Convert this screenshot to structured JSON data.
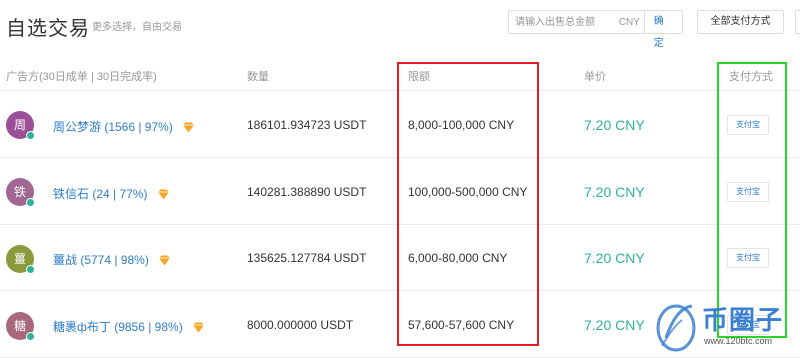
{
  "header": {
    "title": "自选交易",
    "subtitle": "更多选择，自由交易",
    "amount_placeholder": "请输入出售总金额",
    "currency": "CNY",
    "confirm_label": "确定",
    "payment_filter_label": "全部支付方式"
  },
  "columns": {
    "advertiser": "广告方(30日成单 | 30日完成率)",
    "quantity": "数量",
    "limit": "限额",
    "price": "单价",
    "payment": "支付方式"
  },
  "rows": [
    {
      "avatar": "周",
      "avatar_color": "#9b4f96",
      "merchant": "周公梦游 (1566 | 97%)",
      "quantity": "186101.934723 USDT",
      "limit": "8,000-100,000 CNY",
      "price": "7.20 CNY",
      "payment": "支付宝"
    },
    {
      "avatar": "铁",
      "avatar_color": "#a06792",
      "merchant": "铁信石 (24 | 77%)",
      "quantity": "140281.388890 USDT",
      "limit": "100,000-500,000 CNY",
      "price": "7.20 CNY",
      "payment": "支付宝"
    },
    {
      "avatar": "薑",
      "avatar_color": "#8a9a3c",
      "merchant": "薑战 (5774 | 98%)",
      "quantity": "135625.127784 USDT",
      "limit": "6,000-80,000 CNY",
      "price": "7.20 CNY",
      "payment": "支付宝"
    },
    {
      "avatar": "糖",
      "avatar_color": "#a9697c",
      "merchant": "糖裹ф布丁 (9856 | 98%)",
      "quantity": "8000.000000 USDT",
      "limit": "57,600-57,600 CNY",
      "price": "7.20 CNY",
      "payment": "支付宝"
    }
  ],
  "watermark": {
    "name": "币圈子",
    "url": "www.120btc.com"
  },
  "colors": {
    "accent_blue": "#2e7ec9",
    "price_green": "#2eb39a",
    "highlight_red": "#e51c23",
    "highlight_green": "#27d820"
  }
}
